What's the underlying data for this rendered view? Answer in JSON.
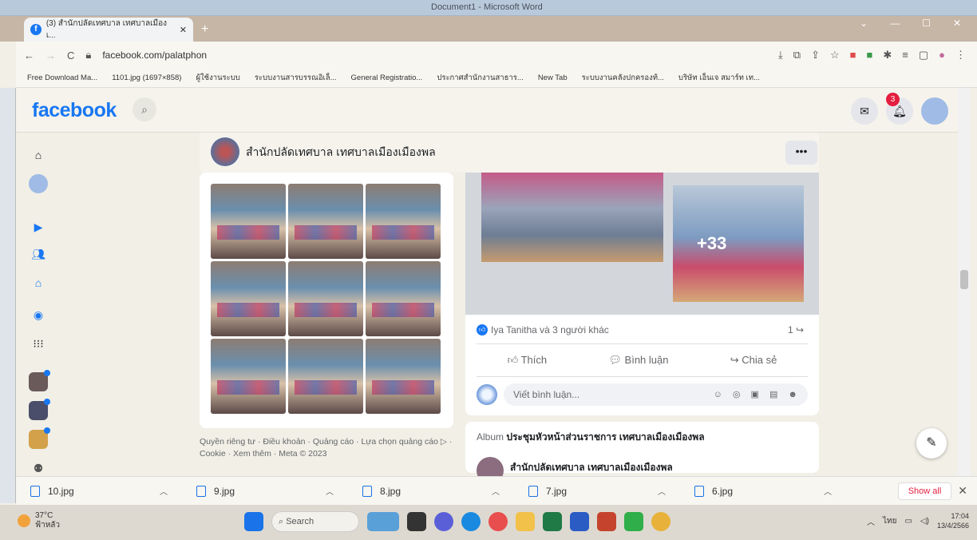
{
  "word": {
    "title": "Document1 - Microsoft Word"
  },
  "browser": {
    "tab_title": "(3) สำนักปลัดเทศบาล เทศบาลเมืองเ...",
    "url": "facebook.com/palatphon",
    "bookmarks": [
      "Free Download Ma...",
      "1101.jpg (1697×858)",
      "ผู้ใช้งานระบบ",
      "ระบบงานสารบรรณอิเล็...",
      "General Registratio...",
      "ประกาศสำนักงานสาธาร...",
      "New Tab",
      "ระบบงานคลังปกครองท้...",
      "บริษัท เอ็นเจ สมาร์ท เท..."
    ]
  },
  "facebook": {
    "logo": "facebook",
    "notification_count": "3",
    "page_name": "สำนักปลัดเทศบาล เทศบาลเมืองเมืองพล",
    "more_label": "•••",
    "photo_more": "+33",
    "likes_text": "Iya Tanitha và 3 người khác",
    "share_count": "1",
    "actions": {
      "like": "Thích",
      "comment": "Bình luận",
      "share": "Chia sẻ"
    },
    "comment_placeholder": "Viết bình luận...",
    "album_prefix": "Album",
    "album_title": "ประชุมหัวหน้าส่วนราชการ เทศบาลเมืองเมืองพล",
    "album_poster": "สำนักปลัดเทศบาล เทศบาลเมืองเมืองพล",
    "footer": "Quyền riêng tư · Điều khoản · Quảng cáo · Lựa chọn quảng cáo ▷ · Cookie · Xem thêm · Meta © 2023"
  },
  "downloads": {
    "files": [
      "10.jpg",
      "9.jpg",
      "8.jpg",
      "7.jpg",
      "6.jpg"
    ],
    "show_all": "Show all"
  },
  "taskbar": {
    "temperature": "37°C",
    "weather": "ฟ้าหลัว",
    "search": "Search",
    "lang": "ไทย",
    "time": "17:04",
    "date": "13/4/2566"
  },
  "colors": {
    "accent": "#1877f2",
    "badge": "#e41e3f"
  },
  "icons": [
    "home-icon",
    "search-icon",
    "messenger-icon",
    "bell-icon",
    "like-icon",
    "comment-icon",
    "share-icon",
    "compose-icon"
  ]
}
